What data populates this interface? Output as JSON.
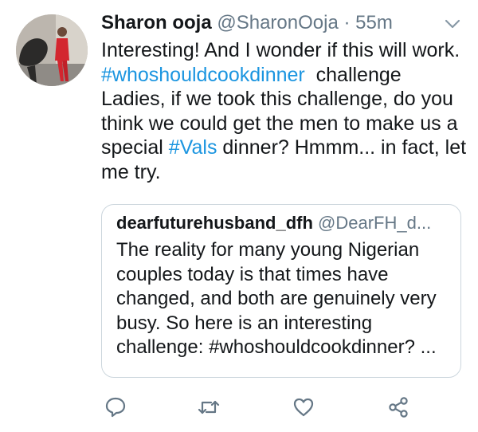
{
  "tweet": {
    "display_name": "Sharon ooja",
    "handle": "@SharonOoja",
    "separator": "·",
    "time": "55m",
    "text_1": "Interesting! And I wonder if this will work. ",
    "hashtag_1": "#whoshouldcookdinner",
    "text_2": "  challenge Ladies, if we took this challenge, do you think we could get the men to make us a special ",
    "hashtag_2": "#Vals",
    "text_3": " dinner? Hmmm... in fact, let me try."
  },
  "quoted_tweet": {
    "display_name": "dearfuturehusband_dfh",
    "handle": "@DearFH_d...",
    "text": "The reality for many young Nigerian couples today is that times have changed, and both are genuinely very busy. So here is an interesting challenge: #whoshouldcookdinner? ..."
  },
  "actions": {
    "icons": [
      "reply-icon",
      "retweet-icon",
      "like-icon",
      "share-icon"
    ],
    "icon_color": "#657786"
  },
  "colors": {
    "link": "#1b95e0",
    "text": "#14171a",
    "secondary": "#657786",
    "border": "#ccd6dd"
  }
}
